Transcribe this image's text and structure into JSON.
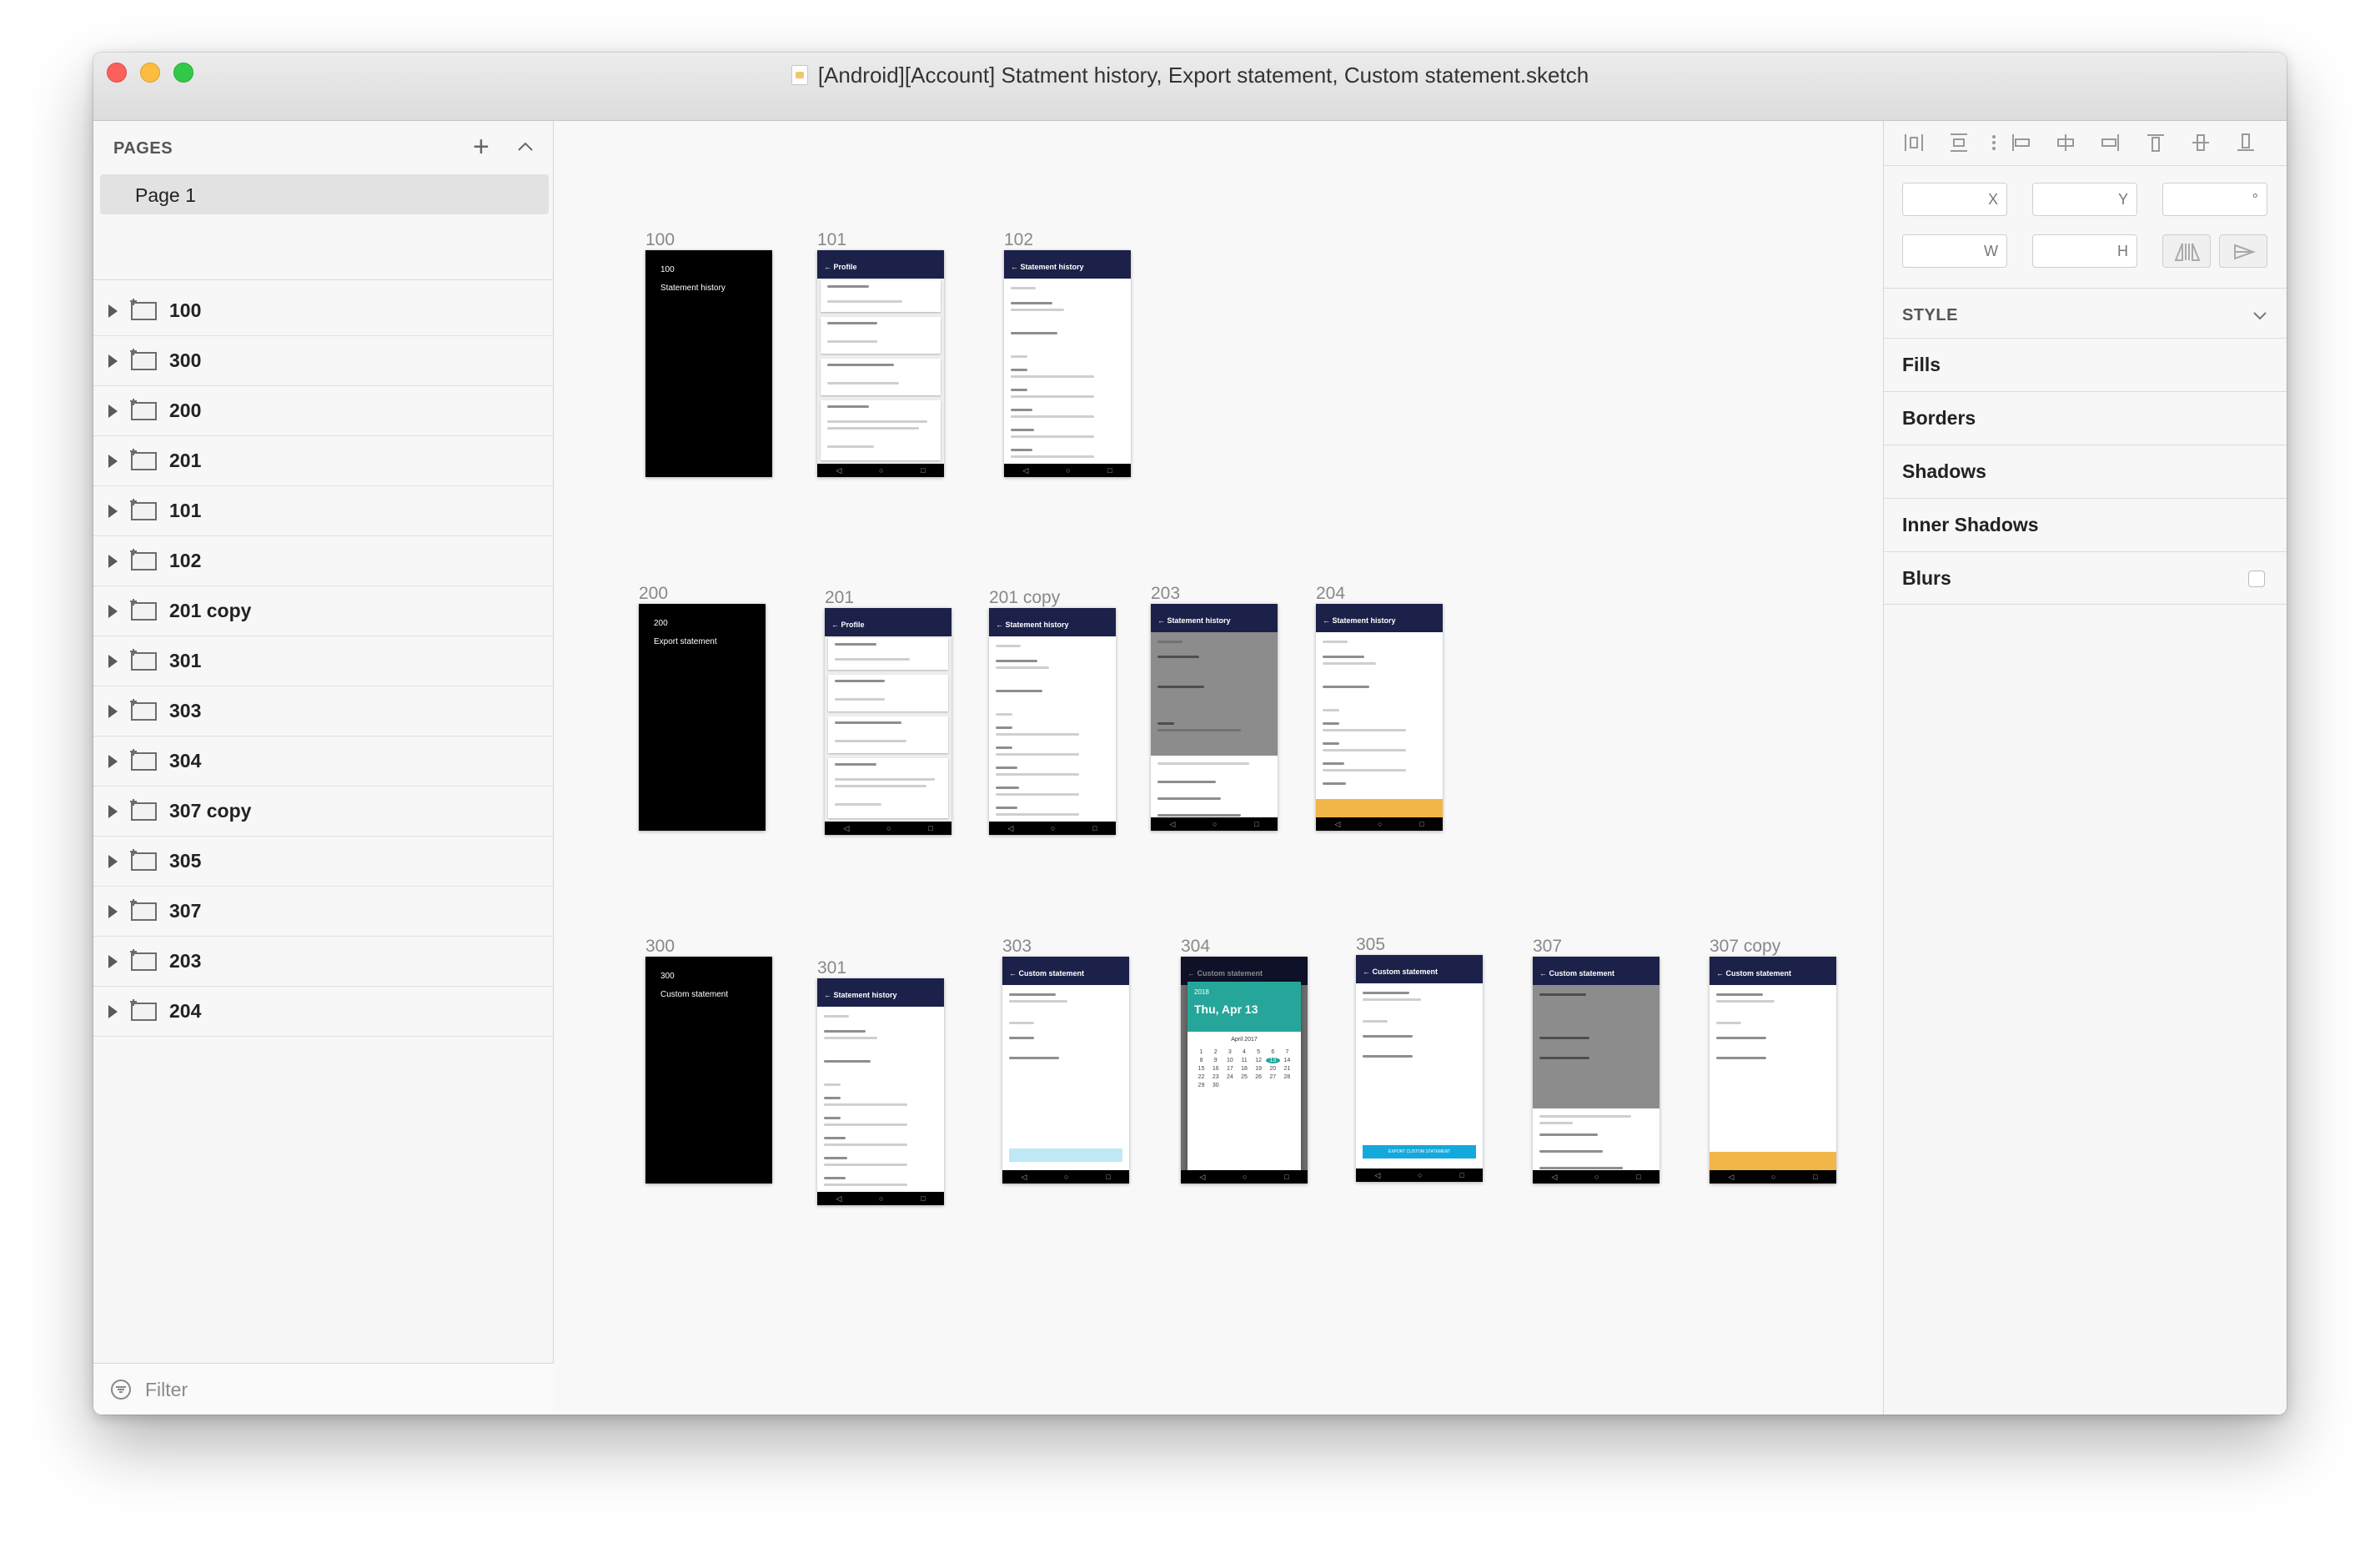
{
  "window": {
    "title": "[Android][Account] Statment history, Export statement, Custom statement.sketch"
  },
  "sidebar": {
    "pages_header": "PAGES",
    "add_icon": "plus-icon",
    "collapse_icon": "chevron-up-icon",
    "pages": [
      {
        "label": "Page 1",
        "selected": true
      }
    ],
    "layers": [
      "100",
      "300",
      "200",
      "201",
      "101",
      "102",
      "201 copy",
      "301",
      "303",
      "304",
      "307 copy",
      "305",
      "307",
      "203",
      "204"
    ],
    "filter_label": "Filter"
  },
  "canvas": {
    "artboards": {
      "a100": {
        "label": "100",
        "number": "100",
        "desc": "Statement history"
      },
      "a101": {
        "label": "101",
        "title": "Profile"
      },
      "a102": {
        "label": "102",
        "title": "Statement history"
      },
      "a200": {
        "label": "200",
        "number": "200",
        "desc": "Export statement"
      },
      "a201": {
        "label": "201",
        "title": "Profile"
      },
      "a201c": {
        "label": "201 copy",
        "title": "Statement history"
      },
      "a203": {
        "label": "203",
        "title": "Statement history"
      },
      "a204": {
        "label": "204",
        "title": "Statement history"
      },
      "a300": {
        "label": "300",
        "number": "300",
        "desc": "Custom statement"
      },
      "a301": {
        "label": "301",
        "title": "Statement history"
      },
      "a303": {
        "label": "303",
        "title": "Custom statement"
      },
      "a304": {
        "label": "304",
        "title": "Custom statement",
        "date_year": "2018",
        "date_big": "Thu, Apr 13",
        "month": "April 2017"
      },
      "a305": {
        "label": "305",
        "title": "Custom statement",
        "button": "EXPORT CUSTOM STATEMENT"
      },
      "a307": {
        "label": "307",
        "title": "Custom statement"
      },
      "a307c": {
        "label": "307 copy",
        "title": "Custom statement"
      }
    },
    "nav_glyphs": [
      "◁",
      "○",
      "□"
    ]
  },
  "inspector": {
    "x_label": "X",
    "y_label": "Y",
    "rotation_label": "°",
    "w_label": "W",
    "h_label": "H",
    "style_header": "STYLE",
    "sections": [
      "Fills",
      "Borders",
      "Shadows",
      "Inner Shadows",
      "Blurs"
    ]
  }
}
